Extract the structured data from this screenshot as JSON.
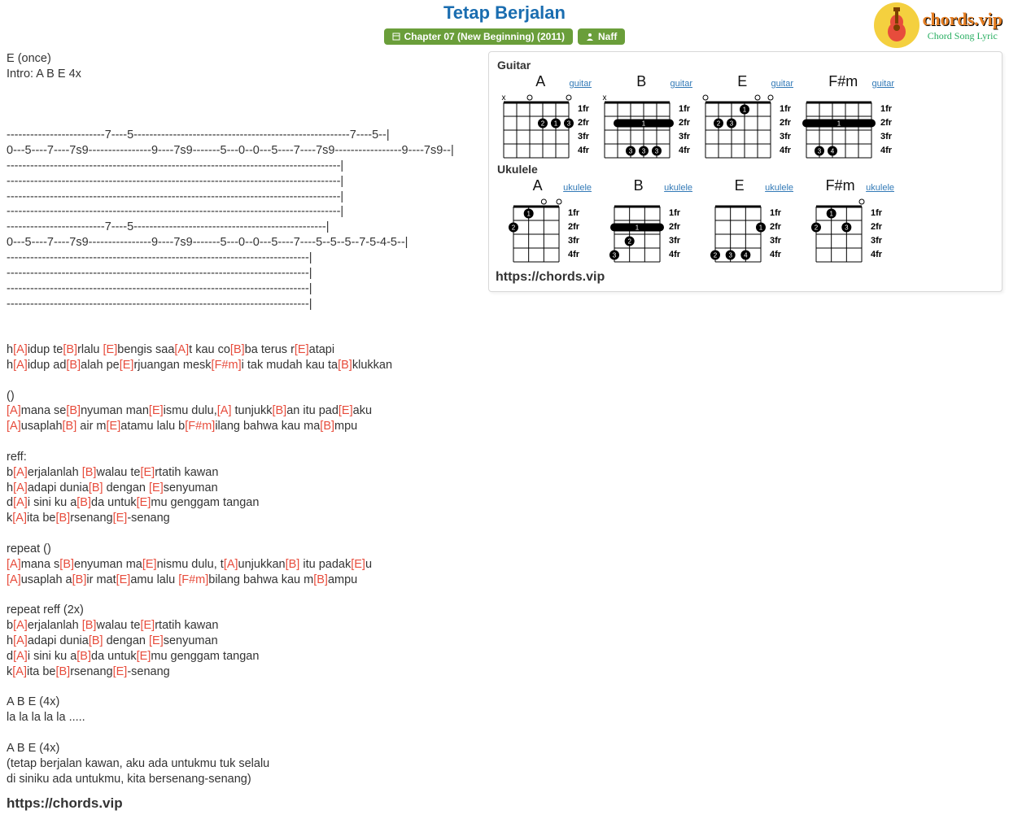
{
  "header": {
    "title": "Tetap Berjalan",
    "album_label": "Chapter 07 (New Beginning) (2011)",
    "artist_label": "Naff",
    "logo_brand": "chords.vip",
    "logo_sub": "Chord Song Lyric"
  },
  "intro": "E (once)\nIntro: A B E 4x\n\n\n\n-------------------------7----5-------------------------------------------------------7----5--|\n0---5----7----7s9----------------9----7s9-------5---0--0---5----7----7s9-----------------9----7s9--|\n-------------------------------------------------------------------------------------|\n-------------------------------------------------------------------------------------|\n-------------------------------------------------------------------------------------|\n-------------------------------------------------------------------------------------|\n-------------------------7----5-------------------------------------------------|\n0---5----7----7s9----------------9----7s9-------5---0--0---5----7----5--5--5--7-5-4-5--|\n-----------------------------------------------------------------------------|\n-----------------------------------------------------------------------------|\n-----------------------------------------------------------------------------|\n-----------------------------------------------------------------------------|\n",
  "segments": [
    {
      "t": "\n\nh",
      "c": ""
    },
    {
      "t": "[A]",
      "c": "c"
    },
    {
      "t": "idup te",
      "c": ""
    },
    {
      "t": "[B]",
      "c": "c"
    },
    {
      "t": "rlalu ",
      "c": ""
    },
    {
      "t": "[E]",
      "c": "c"
    },
    {
      "t": "bengis saa",
      "c": ""
    },
    {
      "t": "[A]",
      "c": "c"
    },
    {
      "t": "t kau co",
      "c": ""
    },
    {
      "t": "[B]",
      "c": "c"
    },
    {
      "t": "ba terus r",
      "c": ""
    },
    {
      "t": "[E]",
      "c": "c"
    },
    {
      "t": "atapi\n",
      "c": ""
    },
    {
      "t": "h",
      "c": ""
    },
    {
      "t": "[A]",
      "c": "c"
    },
    {
      "t": "idup ad",
      "c": ""
    },
    {
      "t": "[B]",
      "c": "c"
    },
    {
      "t": "alah pe",
      "c": ""
    },
    {
      "t": "[E]",
      "c": "c"
    },
    {
      "t": "rjuangan mesk",
      "c": ""
    },
    {
      "t": "[F#m]",
      "c": "c"
    },
    {
      "t": "i tak mudah kau ta",
      "c": ""
    },
    {
      "t": "[B]",
      "c": "c"
    },
    {
      "t": "klukkan\n\n()\n",
      "c": ""
    },
    {
      "t": "[A]",
      "c": "c"
    },
    {
      "t": "mana se",
      "c": ""
    },
    {
      "t": "[B]",
      "c": "c"
    },
    {
      "t": "nyuman man",
      "c": ""
    },
    {
      "t": "[E]",
      "c": "c"
    },
    {
      "t": "ismu dulu,",
      "c": ""
    },
    {
      "t": "[A]",
      "c": "c"
    },
    {
      "t": " tunjukk",
      "c": ""
    },
    {
      "t": "[B]",
      "c": "c"
    },
    {
      "t": "an itu pad",
      "c": ""
    },
    {
      "t": "[E]",
      "c": "c"
    },
    {
      "t": "aku\n",
      "c": ""
    },
    {
      "t": "[A]",
      "c": "c"
    },
    {
      "t": "usaplah",
      "c": ""
    },
    {
      "t": "[B]",
      "c": "c"
    },
    {
      "t": " air m",
      "c": ""
    },
    {
      "t": "[E]",
      "c": "c"
    },
    {
      "t": "atamu lalu b",
      "c": ""
    },
    {
      "t": "[F#m]",
      "c": "c"
    },
    {
      "t": "ilang bahwa kau ma",
      "c": ""
    },
    {
      "t": "[B]",
      "c": "c"
    },
    {
      "t": "mpu\n\nreff:\n",
      "c": ""
    },
    {
      "t": "b",
      "c": ""
    },
    {
      "t": "[A]",
      "c": "c"
    },
    {
      "t": "erjalanlah ",
      "c": ""
    },
    {
      "t": "[B]",
      "c": "c"
    },
    {
      "t": "walau te",
      "c": ""
    },
    {
      "t": "[E]",
      "c": "c"
    },
    {
      "t": "rtatih kawan\n",
      "c": ""
    },
    {
      "t": "h",
      "c": ""
    },
    {
      "t": "[A]",
      "c": "c"
    },
    {
      "t": "adapi dunia",
      "c": ""
    },
    {
      "t": "[B]",
      "c": "c"
    },
    {
      "t": " dengan ",
      "c": ""
    },
    {
      "t": "[E]",
      "c": "c"
    },
    {
      "t": "senyuman\n",
      "c": ""
    },
    {
      "t": "d",
      "c": ""
    },
    {
      "t": "[A]",
      "c": "c"
    },
    {
      "t": "i sini ku a",
      "c": ""
    },
    {
      "t": "[B]",
      "c": "c"
    },
    {
      "t": "da untuk",
      "c": ""
    },
    {
      "t": "[E]",
      "c": "c"
    },
    {
      "t": "mu genggam tangan\n",
      "c": ""
    },
    {
      "t": "k",
      "c": ""
    },
    {
      "t": "[A]",
      "c": "c"
    },
    {
      "t": "ita be",
      "c": ""
    },
    {
      "t": "[B]",
      "c": "c"
    },
    {
      "t": "rsenang",
      "c": ""
    },
    {
      "t": "[E]",
      "c": "c"
    },
    {
      "t": "-senang\n\nrepeat ()\n",
      "c": ""
    },
    {
      "t": "[A]",
      "c": "c"
    },
    {
      "t": "mana s",
      "c": ""
    },
    {
      "t": "[B]",
      "c": "c"
    },
    {
      "t": "enyuman ma",
      "c": ""
    },
    {
      "t": "[E]",
      "c": "c"
    },
    {
      "t": "nismu dulu, t",
      "c": ""
    },
    {
      "t": "[A]",
      "c": "c"
    },
    {
      "t": "unjukkan",
      "c": ""
    },
    {
      "t": "[B]",
      "c": "c"
    },
    {
      "t": " itu padak",
      "c": ""
    },
    {
      "t": "[E]",
      "c": "c"
    },
    {
      "t": "u\n",
      "c": ""
    },
    {
      "t": "[A]",
      "c": "c"
    },
    {
      "t": "usaplah a",
      "c": ""
    },
    {
      "t": "[B]",
      "c": "c"
    },
    {
      "t": "ir mat",
      "c": ""
    },
    {
      "t": "[E]",
      "c": "c"
    },
    {
      "t": "amu lalu ",
      "c": ""
    },
    {
      "t": "[F#m]",
      "c": "c"
    },
    {
      "t": "bilang bahwa kau m",
      "c": ""
    },
    {
      "t": "[B]",
      "c": "c"
    },
    {
      "t": "ampu\n\nrepeat reff (2x)\n",
      "c": ""
    },
    {
      "t": "b",
      "c": ""
    },
    {
      "t": "[A]",
      "c": "c"
    },
    {
      "t": "erjalanlah ",
      "c": ""
    },
    {
      "t": "[B]",
      "c": "c"
    },
    {
      "t": "walau te",
      "c": ""
    },
    {
      "t": "[E]",
      "c": "c"
    },
    {
      "t": "rtatih kawan\n",
      "c": ""
    },
    {
      "t": "h",
      "c": ""
    },
    {
      "t": "[A]",
      "c": "c"
    },
    {
      "t": "adapi dunia",
      "c": ""
    },
    {
      "t": "[B]",
      "c": "c"
    },
    {
      "t": " dengan ",
      "c": ""
    },
    {
      "t": "[E]",
      "c": "c"
    },
    {
      "t": "senyuman\n",
      "c": ""
    },
    {
      "t": "d",
      "c": ""
    },
    {
      "t": "[A]",
      "c": "c"
    },
    {
      "t": "i sini ku a",
      "c": ""
    },
    {
      "t": "[B]",
      "c": "c"
    },
    {
      "t": "da untuk",
      "c": ""
    },
    {
      "t": "[E]",
      "c": "c"
    },
    {
      "t": "mu genggam tangan\n",
      "c": ""
    },
    {
      "t": "k",
      "c": ""
    },
    {
      "t": "[A]",
      "c": "c"
    },
    {
      "t": "ita be",
      "c": ""
    },
    {
      "t": "[B]",
      "c": "c"
    },
    {
      "t": "rsenang",
      "c": ""
    },
    {
      "t": "[E]",
      "c": "c"
    },
    {
      "t": "-senang\n\nA B E (4x)\nla la la la la .....\n\nA B E (4x)\n(tetap berjalan kawan, aku ada untukmu tuk selalu\ndi siniku ada untukmu, kita bersenang-senang)",
      "c": ""
    }
  ],
  "panel": {
    "guitar_label": "Guitar",
    "ukulele_label": "Ukulele",
    "site_link": "https://chords.vip",
    "fret_labels": [
      "1fr",
      "2fr",
      "3fr",
      "4fr"
    ],
    "guitar_link": "guitar",
    "ukulele_link": "ukulele",
    "guitar_chords": [
      {
        "name": "A",
        "strings": 6,
        "top": [
          "x",
          "",
          "o",
          "",
          "",
          "o"
        ],
        "barres": [],
        "dots": [
          {
            "s": 4,
            "f": 2,
            "n": "2"
          },
          {
            "s": 5,
            "f": 2,
            "n": "1"
          },
          {
            "s": 6,
            "f": 2,
            "n": "3"
          }
        ]
      },
      {
        "name": "B",
        "strings": 6,
        "top": [
          "x",
          "",
          "",
          "",
          "",
          ""
        ],
        "barres": [
          {
            "from": 2,
            "to": 6,
            "f": 2,
            "n": "1"
          }
        ],
        "dots": [
          {
            "s": 3,
            "f": 4,
            "n": "3"
          },
          {
            "s": 4,
            "f": 4,
            "n": "3"
          },
          {
            "s": 5,
            "f": 4,
            "n": "3"
          }
        ]
      },
      {
        "name": "E",
        "strings": 6,
        "top": [
          "o",
          "",
          "",
          "",
          "o",
          "o"
        ],
        "barres": [],
        "dots": [
          {
            "s": 4,
            "f": 1,
            "n": "1"
          },
          {
            "s": 2,
            "f": 2,
            "n": "2"
          },
          {
            "s": 3,
            "f": 2,
            "n": "3"
          }
        ]
      },
      {
        "name": "F#m",
        "strings": 6,
        "top": [
          "",
          "",
          "",
          "",
          "",
          ""
        ],
        "barres": [
          {
            "from": 1,
            "to": 6,
            "f": 2,
            "n": "1"
          }
        ],
        "dots": [
          {
            "s": 2,
            "f": 4,
            "n": "3"
          },
          {
            "s": 3,
            "f": 4,
            "n": "4"
          }
        ]
      }
    ],
    "ukulele_chords": [
      {
        "name": "A",
        "strings": 4,
        "top": [
          "",
          "",
          "o",
          "o"
        ],
        "barres": [],
        "dots": [
          {
            "s": 2,
            "f": 1,
            "n": "1"
          },
          {
            "s": 1,
            "f": 2,
            "n": "2"
          }
        ]
      },
      {
        "name": "B",
        "strings": 4,
        "top": [
          "",
          "",
          "",
          ""
        ],
        "barres": [
          {
            "from": 1,
            "to": 4,
            "f": 2,
            "n": "1"
          }
        ],
        "dots": [
          {
            "s": 1,
            "f": 4,
            "n": "3"
          },
          {
            "s": 2,
            "f": 3,
            "n": "2"
          }
        ]
      },
      {
        "name": "E",
        "strings": 4,
        "top": [
          "",
          "",
          "",
          ""
        ],
        "barres": [],
        "dots": [
          {
            "s": 4,
            "f": 2,
            "n": "1"
          },
          {
            "s": 1,
            "f": 4,
            "n": "2"
          },
          {
            "s": 2,
            "f": 4,
            "n": "3"
          },
          {
            "s": 3,
            "f": 4,
            "n": "4"
          }
        ]
      },
      {
        "name": "F#m",
        "strings": 4,
        "top": [
          "",
          "",
          "",
          "o"
        ],
        "barres": [],
        "dots": [
          {
            "s": 2,
            "f": 1,
            "n": "1"
          },
          {
            "s": 1,
            "f": 2,
            "n": "2"
          },
          {
            "s": 3,
            "f": 2,
            "n": "3"
          }
        ]
      }
    ]
  },
  "bottom_link": "https://chords.vip"
}
